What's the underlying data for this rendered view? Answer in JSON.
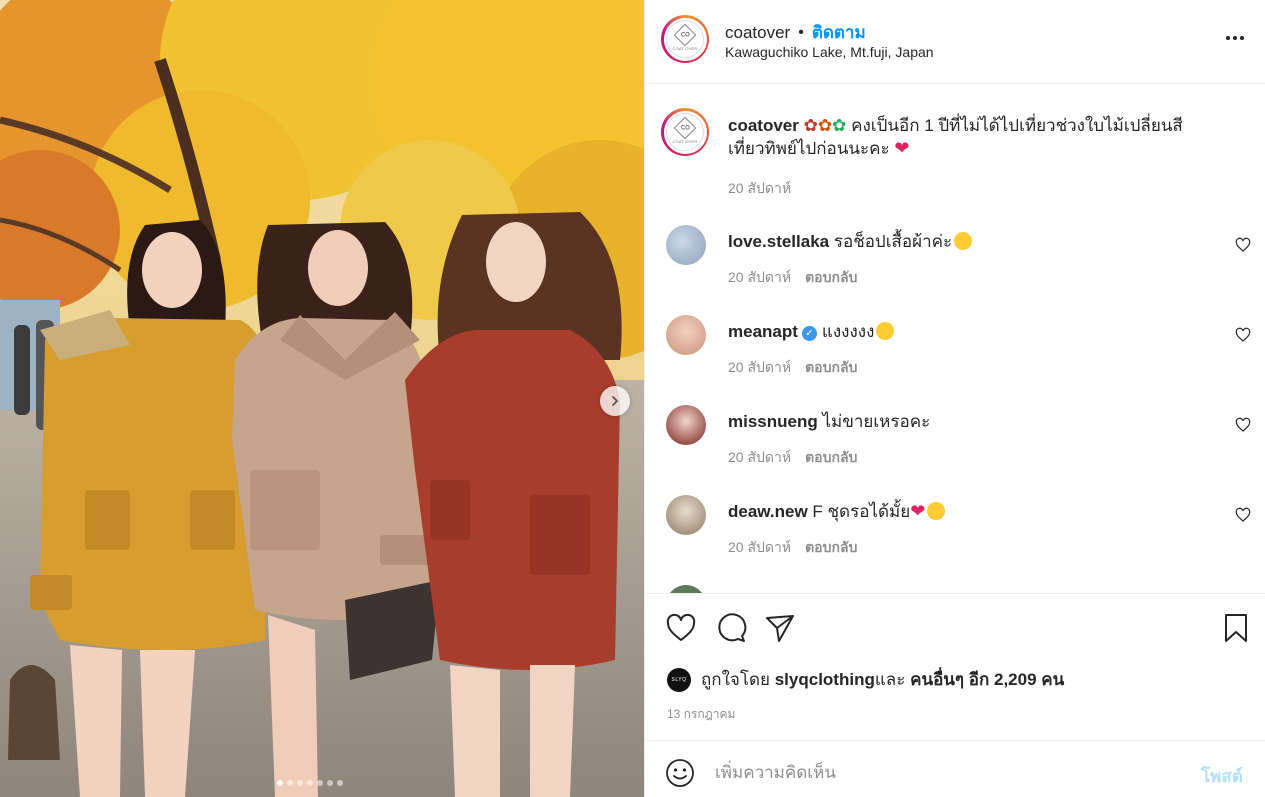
{
  "photo": {
    "alt": "Three women in wool coats under yellow autumn ginkgo trees",
    "carousel_index": 1,
    "carousel_count": 7
  },
  "header": {
    "username": "coatover",
    "separator": "•",
    "follow_label": "ติดตาม",
    "location": "Kawaguchiko Lake, Mt.fuji, Japan",
    "logo_mark": "CO",
    "logo_sub": "COAT OVER"
  },
  "caption": {
    "username": "coatover",
    "text_line1": " คงเป็นอีก 1 ปีที่ไม่ได้ไปเที่ยวช่วงใบไม้เปลี่ยนสี",
    "text_line2": "เที่ยวทิพย์ไปก่อนนะคะ",
    "time": "20 สัปดาห์"
  },
  "comments": [
    {
      "username": "love.stellaka",
      "text": " รอช็อปเสื้อผ้าค่ะ",
      "time": "20 สัปดาห์",
      "reply": "ตอบกลับ",
      "verified": false
    },
    {
      "username": "meanapt",
      "text": "แงงงงง",
      "time": "20 สัปดาห์",
      "reply": "ตอบกลับ",
      "verified": true
    },
    {
      "username": "missnueng",
      "text": " ไม่ขายเหรอคะ",
      "time": "20 สัปดาห์",
      "reply": "ตอบกลับ",
      "verified": false
    },
    {
      "username": "deaw.new",
      "text": " F ชุดรอได้มั้ย",
      "time": "20 สัปดาห์",
      "reply": "ตอบกลับ",
      "verified": false
    }
  ],
  "likes": {
    "prefix": "ถูกใจโดย ",
    "user": "slyqclothing",
    "middle": " และ ",
    "others": "คนอื่นๆ อีก 2,209 คน",
    "avatar_text": "SLYQ"
  },
  "post_date": "13 กรกฎาคม",
  "compose": {
    "placeholder": "เพิ่มความคิดเห็น",
    "post_label": "โพสต์"
  },
  "colors": {
    "accent": "#0095f6",
    "post_disabled": "#b2dffc",
    "muted": "#8e8e8e",
    "text": "#262626"
  },
  "icons": [
    "heart-icon",
    "comment-icon",
    "share-icon",
    "bookmark-icon",
    "smile-icon",
    "more-icon",
    "chevron-right-icon",
    "verified-icon"
  ]
}
